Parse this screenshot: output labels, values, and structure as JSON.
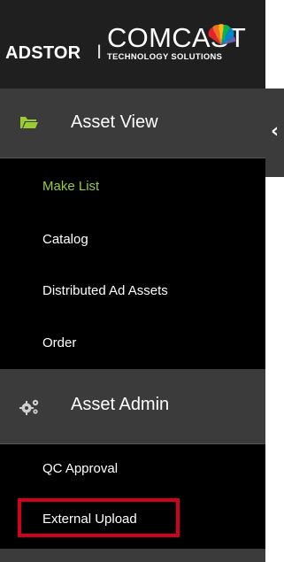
{
  "header": {
    "app_name": "ADSTOR",
    "separator": "I",
    "company": "COMCAST",
    "company_sub": "TECHNOLOGY SOLUTIONS"
  },
  "sidebar": {
    "sections": [
      {
        "label": "Asset View",
        "icon": "folder-open-icon",
        "items": [
          {
            "label": "Make List",
            "active": true
          },
          {
            "label": "Catalog",
            "active": false
          },
          {
            "label": "Distributed Ad Assets",
            "active": false
          },
          {
            "label": "Order",
            "active": false
          }
        ]
      },
      {
        "label": "Asset Admin",
        "icon": "gears-icon",
        "items": [
          {
            "label": "QC Approval",
            "active": false
          },
          {
            "label": "External Upload",
            "active": false,
            "highlighted": true
          }
        ]
      }
    ],
    "collapse_icon": "chevron-left-icon"
  },
  "colors": {
    "header_bg": "#1f1f1f",
    "sidebar_bg": "#000000",
    "section_bg": "#3b3b3b",
    "active_item": "#9acd32",
    "folder_icon": "#9acd32",
    "highlight_box": "#d0021b"
  }
}
